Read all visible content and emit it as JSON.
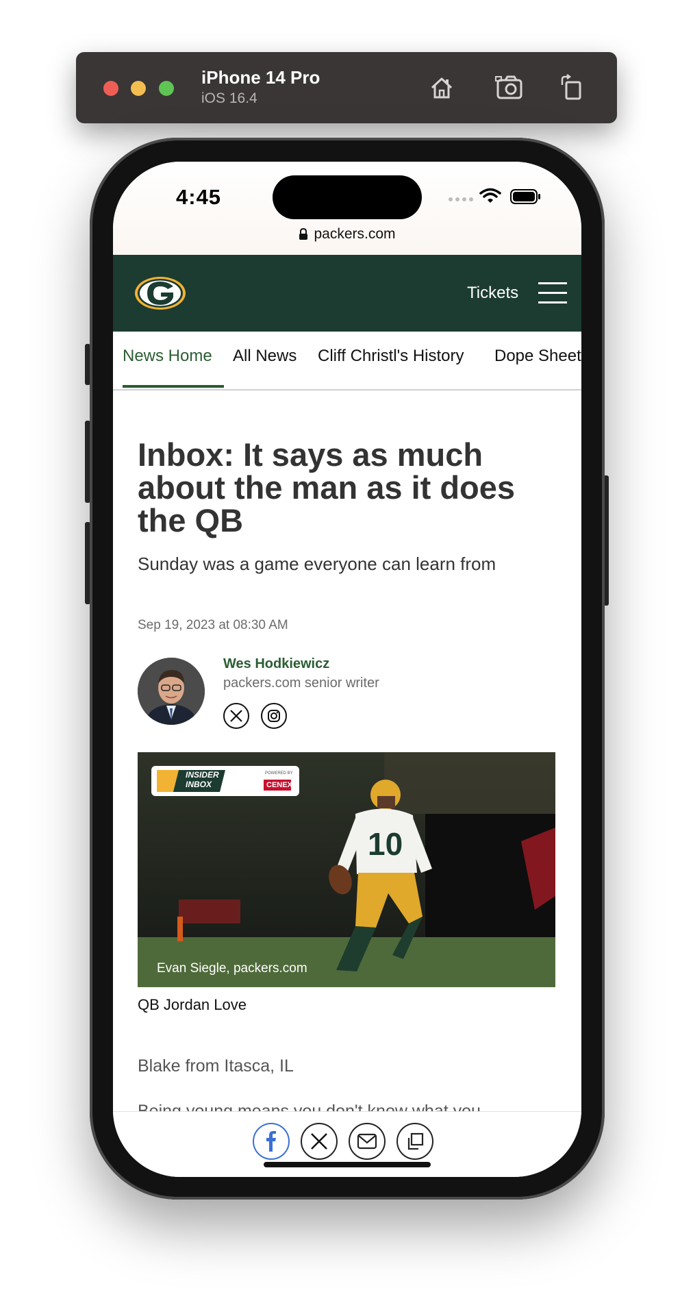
{
  "simulator": {
    "device_name": "iPhone 14 Pro",
    "os_version": "iOS 16.4",
    "tools": [
      "home-icon",
      "screenshot-icon",
      "rotate-icon"
    ]
  },
  "status_bar": {
    "time": "4:45",
    "url": "packers.com"
  },
  "site_header": {
    "tickets_label": "Tickets"
  },
  "nav_tabs": [
    {
      "label": "News Home",
      "active": true
    },
    {
      "label": "All News",
      "active": false
    },
    {
      "label": "Cliff Christl's History",
      "active": false
    },
    {
      "label": "Dope Sheet",
      "active": false
    }
  ],
  "article": {
    "headline": "Inbox: It says as much about the man as it does the QB",
    "subheadline": "Sunday was a game everyone can learn from",
    "date": "Sep 19, 2023 at 08:30 AM",
    "author": {
      "name": "Wes Hodkiewicz",
      "role": "packers.com senior writer",
      "social": [
        "x-icon",
        "instagram-icon"
      ]
    },
    "image": {
      "badge_text": "INSIDER INBOX",
      "badge_sponsor": "CENEX",
      "badge_sponsor_prefix": "POWERED BY",
      "jersey_number": "10",
      "credit": "Evan Siegle, packers.com",
      "caption": "QB Jordan Love"
    },
    "body": [
      "Blake from Itasca, IL",
      "Being young means you don't know what you"
    ]
  },
  "share_bar": {
    "items": [
      "facebook-icon",
      "x-icon",
      "email-icon",
      "copy-icon"
    ]
  },
  "colors": {
    "packers_green": "#1c3b31",
    "accent_green": "#2a5d32",
    "gold": "#f2b233",
    "facebook_blue": "#3b6fd4"
  }
}
